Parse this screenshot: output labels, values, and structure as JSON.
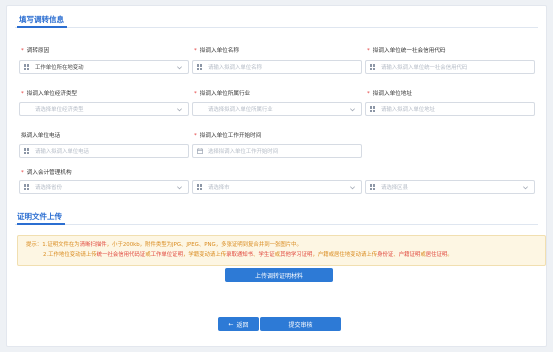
{
  "section1": {
    "title": "填写调转信息"
  },
  "fields": {
    "reason": {
      "label": "调转原因",
      "required": true,
      "value": "工作单位所在地变动",
      "icon": "grid-icon"
    },
    "unit_name": {
      "label": "拟调入单位名称",
      "required": true,
      "placeholder": "请输入拟调入单位名称"
    },
    "credit_code": {
      "label": "拟调入单位统一社会信用代码",
      "required": true,
      "placeholder": "请输入拟调入单位统一社会信用代码"
    },
    "economy_type": {
      "label": "拟调入单位经济类型",
      "required": true,
      "placeholder": "请选择单位经济类型"
    },
    "industry": {
      "label": "拟调入单位所属行业",
      "required": true,
      "placeholder": "请选择拟调入单位所属行业"
    },
    "address": {
      "label": "拟调入单位地址",
      "required": true,
      "placeholder": "请输入拟调入单位地址"
    },
    "phone": {
      "label": "拟调入单位电话",
      "required": false,
      "placeholder": "请输入拟调入单位电话"
    },
    "start_time": {
      "label": "拟调入单位工作开始时间",
      "required": true,
      "placeholder": "选择拟调入单位工作开始时间"
    },
    "accounting_org": {
      "label": "调入会计管理机构",
      "required": true,
      "province_placeholder": "请选择省份",
      "city_placeholder": "请选择市",
      "district_placeholder": "请选择区县"
    }
  },
  "section2": {
    "title": "证明文件上传"
  },
  "notice": {
    "prefix": "提示：",
    "line1_a": "1.证明文件在为",
    "line1_b": "清晰扫描件",
    "line1_c": "，小于200kb，附件类型为JPG、JPEG、PNG，多张证明到复合并到一张图片中。",
    "line2_a": "2.工作地位变动请上传",
    "line2_b": "统一社会信用代码证",
    "line2_c": "或",
    "line2_d": "工作单位证明",
    "line2_e": "，学籍变动请上传",
    "line2_f": "录取通知书",
    "line2_g": "、",
    "line2_h": "学生证",
    "line2_i": "或",
    "line2_j": "其他学习证明",
    "line2_k": "，户籍或居住地变动请上传",
    "line2_l": "身份证",
    "line2_m": "、",
    "line2_n": "户籍证明",
    "line2_o": "或",
    "line2_p": "居住证明",
    "line2_q": "。"
  },
  "buttons": {
    "upload": "上传调转证明材料",
    "back": "返回",
    "submit": "提交审核"
  },
  "colors": {
    "accent": "#2b6ed1",
    "required": "#e23b3b",
    "notice_bg": "#fdf6e3",
    "notice_text": "#d98a1d"
  }
}
